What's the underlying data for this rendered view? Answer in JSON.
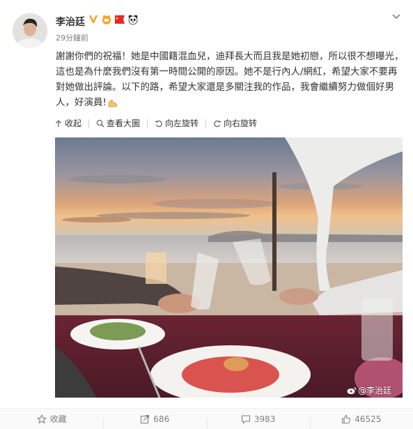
{
  "post": {
    "username": "李治廷",
    "timestamp": "29分鐘前",
    "text": "謝謝你們的祝福！她是中國籍混血兒，迪拜長大而且我是她初戀，所以很不想曝光，這也是為什麼我們沒有第一時間公開的原因。她不是行內人/網紅，希望大家不要再對她做出評論。以下的路，希望大家還是多關注我的作品，我會繼續努力做個好男人，好演員!",
    "badges": [
      "verified-v-badge",
      "vip-badge",
      "china-flag-badge",
      "panda-badge"
    ],
    "emoji": "flexed-arm-emoji"
  },
  "toolbar": {
    "collapse": "收起",
    "view_large": "查看大圖",
    "rotate_left": "向左旋转",
    "rotate_right": "向右旋转"
  },
  "photo": {
    "watermark": "@李治廷",
    "description_icon": "weibo-logo-icon"
  },
  "footer": {
    "favorite": "收藏",
    "repost": "686",
    "comment": "3983",
    "like": "46525"
  },
  "colors": {
    "accent": "#eb7350",
    "text": "#333333",
    "muted": "#808080"
  }
}
